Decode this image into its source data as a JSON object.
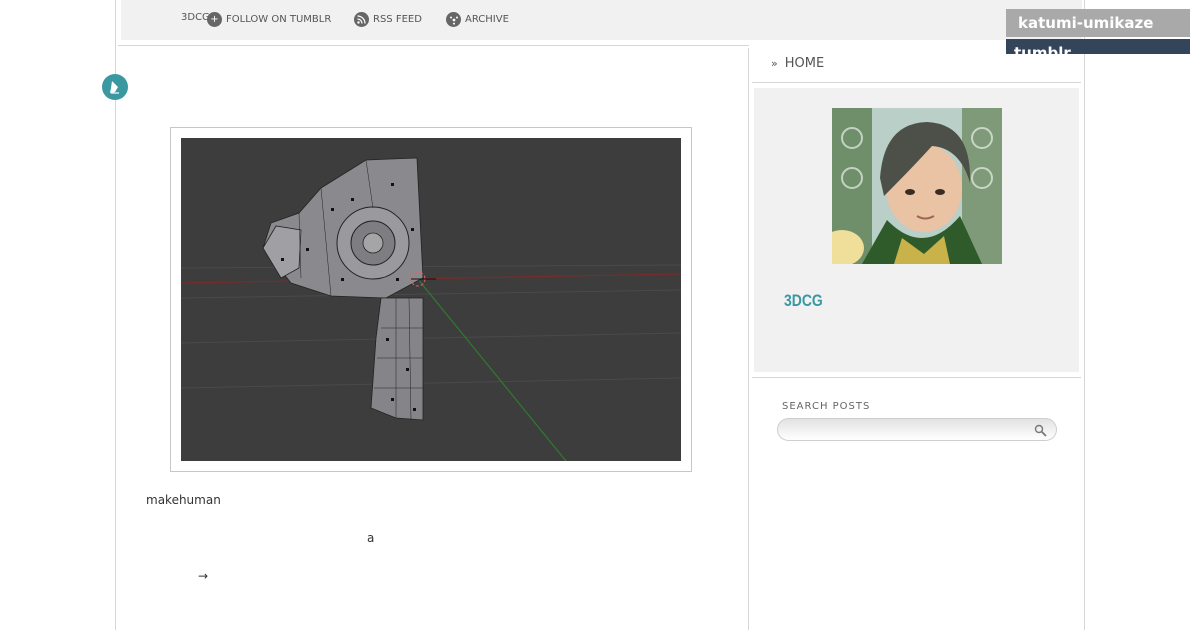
{
  "nav": {
    "items": [
      {
        "label": "3DCG",
        "icon": "none"
      },
      {
        "label": "FOLLOW ON TUMBLR",
        "icon": "plus-icon"
      },
      {
        "label": "RSS FEED",
        "icon": "rss-icon"
      },
      {
        "label": "ARCHIVE",
        "icon": "archive-icon"
      }
    ]
  },
  "tumblr_bar": {
    "username": "katumi-umikaze",
    "brand": "tumblr."
  },
  "post": {
    "line1": "makehuman",
    "line2": "a",
    "line3": "→"
  },
  "sidebar": {
    "home_label": "HOME",
    "blog_title": "3DCG",
    "search_label": "SEARCH POSTS",
    "search_value": ""
  },
  "colors": {
    "accent": "#3a98a1",
    "topbar": "#f1f1f1",
    "tumblr_tab": "#a9a9a9",
    "tumblr_dark": "#34445a"
  }
}
